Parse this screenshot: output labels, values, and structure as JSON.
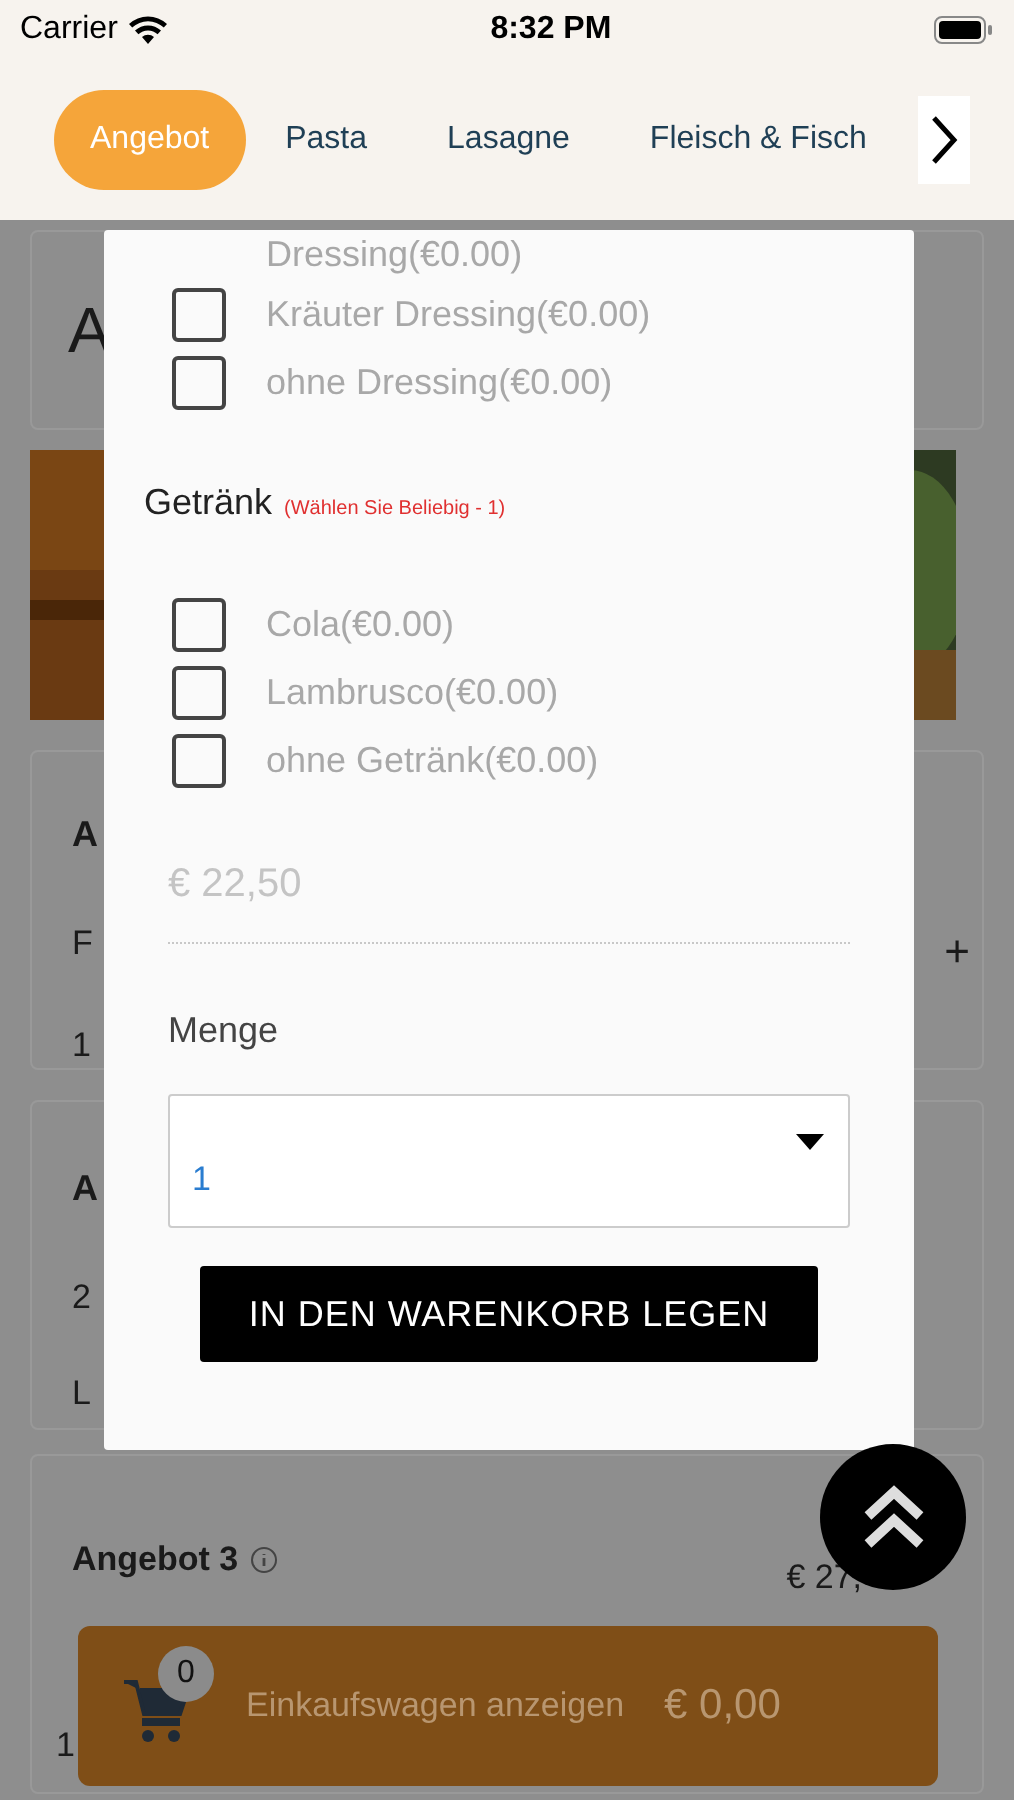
{
  "status_bar": {
    "carrier": "Carrier",
    "time": "8:32 PM"
  },
  "tabs": [
    {
      "label": "Angebot",
      "selected": true
    },
    {
      "label": "Pasta",
      "selected": false
    },
    {
      "label": "Lasagne",
      "selected": false
    },
    {
      "label": "Fleisch & Fisch",
      "selected": false
    }
  ],
  "page": {
    "card_1": {
      "title": "A"
    },
    "card_2": {
      "title": "A",
      "line_1": "F",
      "plus": "+",
      "line_2": "1"
    },
    "card_3": {
      "title": "A",
      "line_1": "2",
      "line_2": "L"
    },
    "card_4": {
      "title": "Angebot 3",
      "price": "€ 27,",
      "line_2": "1"
    }
  },
  "modal": {
    "cut_label": "Dressing(€0.00)",
    "dressing_options": [
      {
        "label": "Kräuter Dressing(€0.00)",
        "checked": false
      },
      {
        "label": "ohne Dressing(€0.00)",
        "checked": false
      }
    ],
    "group": {
      "title": "Getränk",
      "note": "(Wählen Sie Beliebig - 1)"
    },
    "drink_options": [
      {
        "label": "Cola(€0.00)",
        "checked": false
      },
      {
        "label": "Lambrusco(€0.00)",
        "checked": false
      },
      {
        "label": "ohne Getränk(€0.00)",
        "checked": false
      }
    ],
    "price": "€ 22,50",
    "quantity_label": "Menge",
    "quantity": "1",
    "add_button": "IN DEN WARENKORB LEGEN"
  },
  "cart": {
    "count": "0",
    "label": "Einkaufswagen anzeigen",
    "total": "€ 0,00"
  }
}
